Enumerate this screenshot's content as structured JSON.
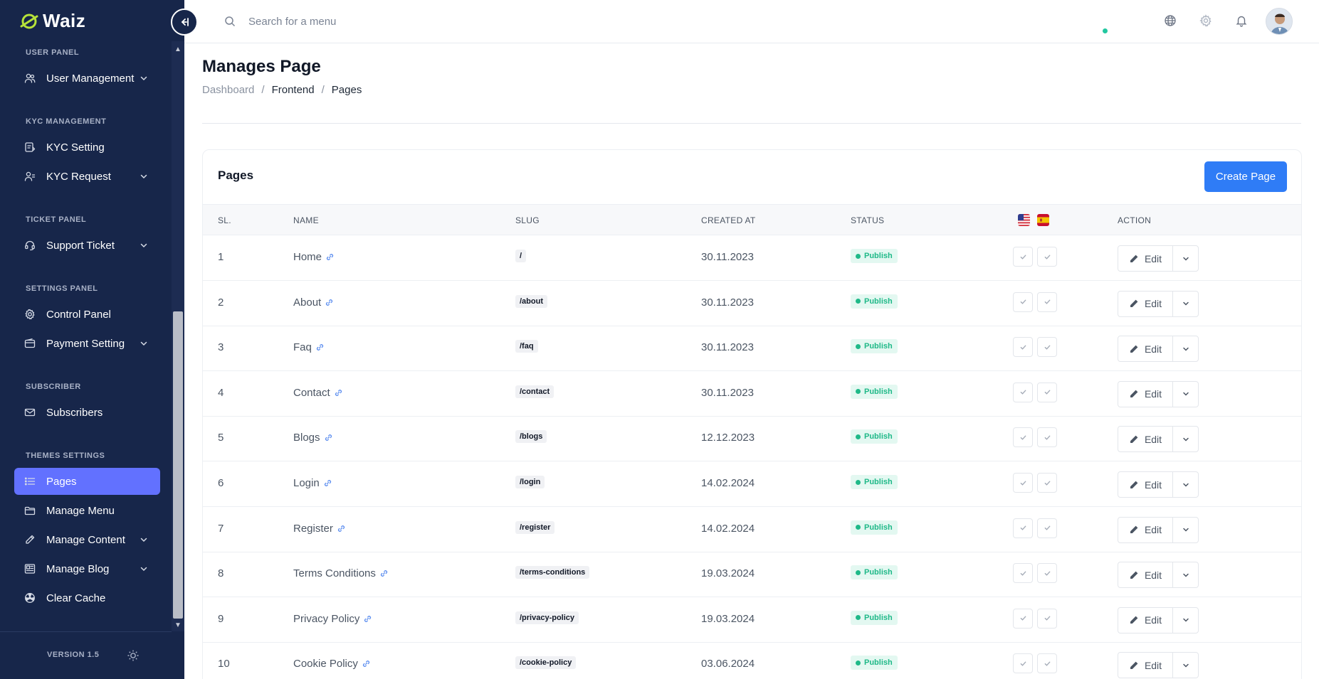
{
  "brand": {
    "name": "Waiz",
    "accent": "#6271ff",
    "logo_color": "#b6e23a"
  },
  "sidebar": {
    "sections": [
      {
        "title": "USER PANEL",
        "items": [
          {
            "label": "User Management",
            "icon": "users-icon",
            "has_children": true
          }
        ]
      },
      {
        "title": "KYC MANAGEMENT",
        "items": [
          {
            "label": "KYC Setting",
            "icon": "kyc-setting-icon",
            "has_children": false
          },
          {
            "label": "KYC Request",
            "icon": "kyc-request-icon",
            "has_children": true
          }
        ]
      },
      {
        "title": "TICKET PANEL",
        "items": [
          {
            "label": "Support Ticket",
            "icon": "headset-icon",
            "has_children": true
          }
        ]
      },
      {
        "title": "SETTINGS PANEL",
        "items": [
          {
            "label": "Control Panel",
            "icon": "gear-icon",
            "has_children": false
          },
          {
            "label": "Payment Setting",
            "icon": "wallet-icon",
            "has_children": true
          }
        ]
      },
      {
        "title": "SUBSCRIBER",
        "items": [
          {
            "label": "Subscribers",
            "icon": "mail-icon",
            "has_children": false
          }
        ]
      },
      {
        "title": "THEMES SETTINGS",
        "items": [
          {
            "label": "Pages",
            "icon": "list-icon",
            "has_children": false,
            "active": true
          },
          {
            "label": "Manage Menu",
            "icon": "folder-icon",
            "has_children": false
          },
          {
            "label": "Manage Content",
            "icon": "pencil-icon",
            "has_children": true
          },
          {
            "label": "Manage Blog",
            "icon": "blog-icon",
            "has_children": true
          },
          {
            "label": "Clear Cache",
            "icon": "radiation-icon",
            "has_children": false
          }
        ]
      }
    ],
    "version": "VERSION 1.5"
  },
  "header": {
    "search_placeholder": "Search for a menu"
  },
  "page": {
    "title": "Manages Page",
    "breadcrumb": [
      "Dashboard",
      "Frontend",
      "Pages"
    ]
  },
  "card": {
    "title": "Pages",
    "create_button": "Create Page",
    "columns": [
      "SL.",
      "NAME",
      "SLUG",
      "CREATED AT",
      "STATUS",
      "ACTION"
    ],
    "language_flags": [
      "us-flag-icon",
      "es-flag-icon"
    ],
    "status_color": "#1fb988",
    "edit_label": "Edit",
    "rows": [
      {
        "sl": "1",
        "name": "Home",
        "slug": "/",
        "created": "30.11.2023",
        "status": "Publish"
      },
      {
        "sl": "2",
        "name": "About",
        "slug": "/about",
        "created": "30.11.2023",
        "status": "Publish"
      },
      {
        "sl": "3",
        "name": "Faq",
        "slug": "/faq",
        "created": "30.11.2023",
        "status": "Publish"
      },
      {
        "sl": "4",
        "name": "Contact",
        "slug": "/contact",
        "created": "30.11.2023",
        "status": "Publish"
      },
      {
        "sl": "5",
        "name": "Blogs",
        "slug": "/blogs",
        "created": "12.12.2023",
        "status": "Publish"
      },
      {
        "sl": "6",
        "name": "Login",
        "slug": "/login",
        "created": "14.02.2024",
        "status": "Publish"
      },
      {
        "sl": "7",
        "name": "Register",
        "slug": "/register",
        "created": "14.02.2024",
        "status": "Publish"
      },
      {
        "sl": "8",
        "name": "Terms Conditions",
        "slug": "/terms-conditions",
        "created": "19.03.2024",
        "status": "Publish"
      },
      {
        "sl": "9",
        "name": "Privacy Policy",
        "slug": "/privacy-policy",
        "created": "19.03.2024",
        "status": "Publish"
      },
      {
        "sl": "10",
        "name": "Cookie Policy",
        "slug": "/cookie-policy",
        "created": "03.06.2024",
        "status": "Publish"
      }
    ]
  }
}
